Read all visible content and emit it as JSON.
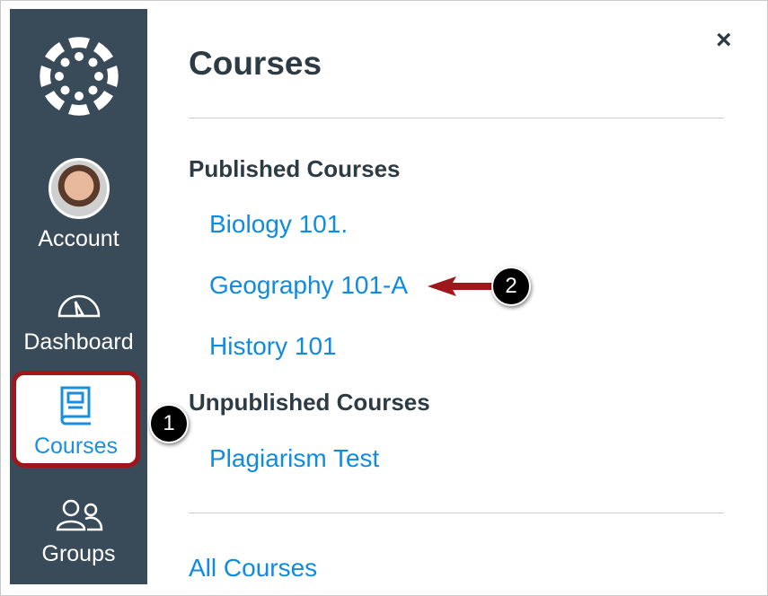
{
  "sidebar": {
    "items": [
      {
        "label": "Account",
        "icon": "avatar"
      },
      {
        "label": "Dashboard",
        "icon": "dashboard-gauge-icon"
      },
      {
        "label": "Courses",
        "icon": "book-icon",
        "active": true
      },
      {
        "label": "Groups",
        "icon": "groups-icon"
      }
    ]
  },
  "tray": {
    "title": "Courses",
    "close_label": "×",
    "published_heading": "Published Courses",
    "published": [
      "Biology 101.",
      "Geography 101-A",
      "History 101"
    ],
    "unpublished_heading": "Unpublished Courses",
    "unpublished": [
      "Plagiarism Test"
    ],
    "all_courses": "All Courses"
  },
  "annotations": {
    "one": "1",
    "two": "2"
  },
  "colors": {
    "sidebar": "#394b58",
    "link": "#0f8be0",
    "highlight": "#a0161c"
  }
}
